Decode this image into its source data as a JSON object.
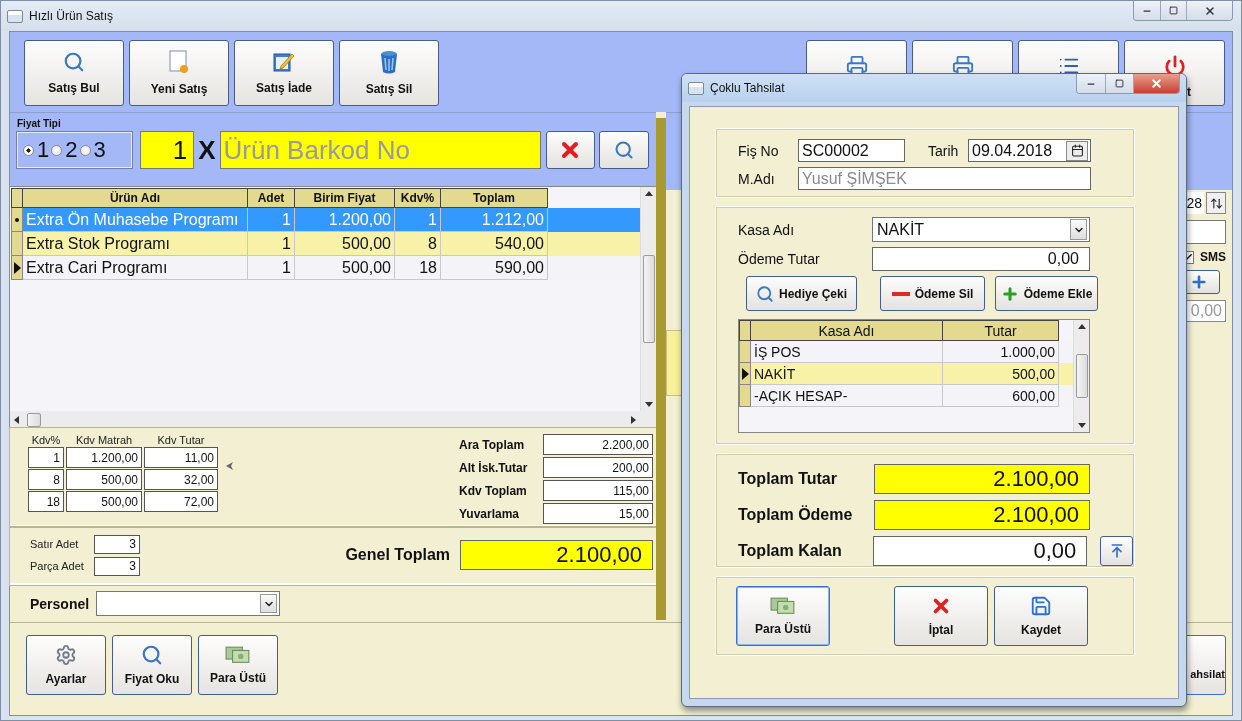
{
  "window": {
    "title": "Hızlı Ürün Satış"
  },
  "toolbar": {
    "left": [
      {
        "label": "Satış Bul"
      },
      {
        "label": "Yeni Satış"
      },
      {
        "label": "Satış İade"
      },
      {
        "label": "Satış Sil"
      }
    ],
    "right_last_label": "t"
  },
  "price_type": {
    "label": "Fiyat Tipi",
    "options": [
      {
        "label": "1",
        "selected": true
      },
      {
        "label": "2",
        "selected": false
      },
      {
        "label": "3",
        "selected": false
      }
    ]
  },
  "quantity": "1",
  "times": "X",
  "barcode": {
    "placeholder": "Ürün Barkod No"
  },
  "items_table": {
    "columns": [
      "Ürün Adı",
      "Adet",
      "Birim Fiyat",
      "Kdv%",
      "Toplam"
    ],
    "rows": [
      {
        "selected": true,
        "current": false,
        "cells": [
          "Extra Ön Muhasebe Programı",
          "1",
          "1.200,00",
          "1",
          "1.212,00"
        ]
      },
      {
        "selected": false,
        "current": false,
        "cells": [
          "Extra Stok Programı",
          "1",
          "500,00",
          "8",
          "540,00"
        ]
      },
      {
        "selected": false,
        "current": true,
        "cells": [
          "Extra Cari Programı",
          "1",
          "500,00",
          "18",
          "590,00"
        ]
      }
    ]
  },
  "kdv_table": {
    "columns": [
      "Kdv%",
      "Kdv Matrah",
      "Kdv Tutar"
    ],
    "rows": [
      [
        "1",
        "1.200,00",
        "11,00"
      ],
      [
        "8",
        "500,00",
        "32,00"
      ],
      [
        "18",
        "500,00",
        "72,00"
      ]
    ]
  },
  "summary": [
    {
      "label": "Ara Toplam",
      "value": "2.200,00"
    },
    {
      "label": "Alt İsk.Tutar",
      "value": "200,00"
    },
    {
      "label": "Kdv Toplam",
      "value": "115,00"
    },
    {
      "label": "Yuvarlama",
      "value": "15,00"
    }
  ],
  "counts": [
    {
      "label": "Satır Adet",
      "value": "3"
    },
    {
      "label": "Parça Adet",
      "value": "3"
    }
  ],
  "grand_total": {
    "label": "Genel Toplam",
    "value": "2.100,00"
  },
  "personel": {
    "label": "Personel"
  },
  "bottom_buttons": [
    "Ayarlar",
    "Fiyat Oku",
    "Para Üstü"
  ],
  "right_panel": {
    "spinner_value": "28",
    "sms": {
      "label": "SMS",
      "checked": true
    },
    "amount": "0,00",
    "tahsilat_button": "ahsilat"
  },
  "dialog": {
    "title": "Çoklu Tahsilat",
    "receipt_no": {
      "label": "Fiş No",
      "value": "SC00002"
    },
    "date": {
      "label": "Tarih",
      "value": "09.04.2018"
    },
    "customer": {
      "label": "M.Adı",
      "value": "Yusuf ŞİMŞEK",
      "disabled": true
    },
    "cash_register": {
      "label": "Kasa Adı",
      "value": "NAKİT"
    },
    "payment_amount": {
      "label": "Ödeme Tutar",
      "value": "0,00"
    },
    "actions": [
      "Hediye Çeki",
      "Ödeme Sil",
      "Ödeme Ekle"
    ],
    "payments_table": {
      "columns": [
        "Kasa Adı",
        "Tutar"
      ],
      "rows": [
        {
          "selected": false,
          "cells": [
            "İŞ POS",
            "1.000,00"
          ]
        },
        {
          "selected": true,
          "cells": [
            "NAKİT",
            "500,00"
          ]
        },
        {
          "selected": false,
          "cells": [
            "-AÇIK HESAP-",
            "600,00"
          ]
        }
      ]
    },
    "totals": [
      {
        "label": "Toplam Tutar",
        "value": "2.100,00",
        "highlighted": true
      },
      {
        "label": "Toplam Ödeme",
        "value": "2.100,00",
        "highlighted": true
      },
      {
        "label": "Toplam Kalan",
        "value": "0,00",
        "highlighted": false
      }
    ],
    "footer_buttons": [
      {
        "label": "Para Üstü",
        "default": true
      },
      {
        "label": "İptal",
        "default": false
      },
      {
        "label": "Kaydet",
        "default": false
      }
    ]
  }
}
